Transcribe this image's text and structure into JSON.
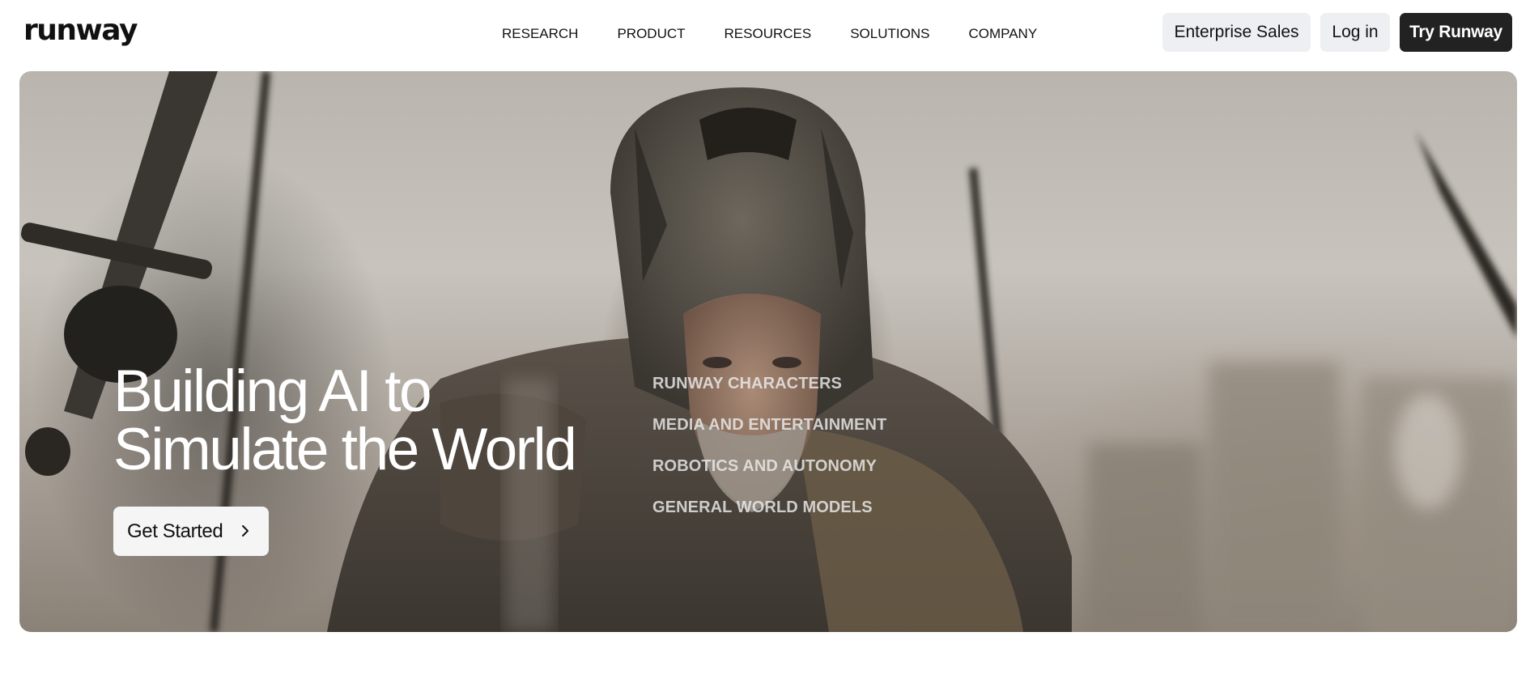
{
  "header": {
    "logo": "runway",
    "nav": [
      "RESEARCH",
      "PRODUCT",
      "RESOURCES",
      "SOLUTIONS",
      "COMPANY"
    ],
    "enterprise_label": "Enterprise Sales",
    "login_label": "Log in",
    "try_label": "Try Runway"
  },
  "hero": {
    "title_line1": "Building AI to",
    "title_line2": "Simulate the World",
    "cta_label": "Get Started",
    "solutions": [
      "RUNWAY CHARACTERS",
      "MEDIA AND ENTERTAINMENT",
      "ROBOTICS AND AUTONOMY",
      "GENERAL WORLD MODELS"
    ]
  },
  "colors": {
    "primary_button": "#222222",
    "secondary_button": "#edeff2",
    "hero_text": "#ffffff"
  }
}
